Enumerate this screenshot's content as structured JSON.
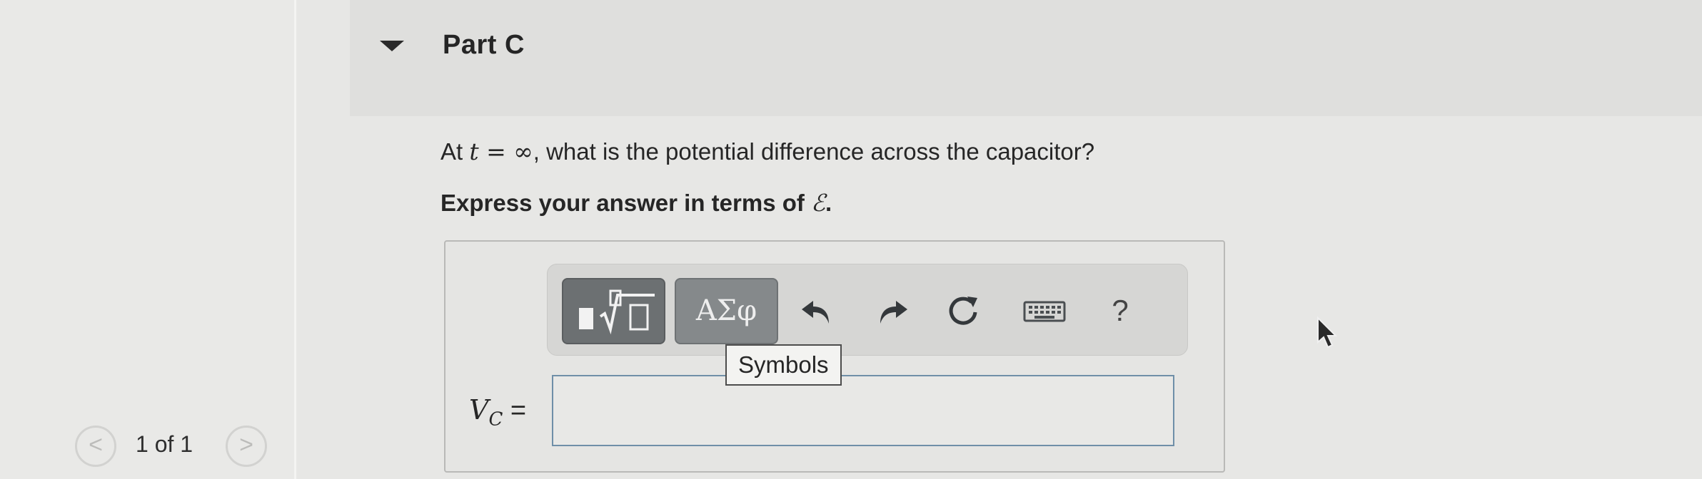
{
  "pager": {
    "prev_label": "<",
    "next_label": ">",
    "text": "1 of 1"
  },
  "part": {
    "title": "Part C"
  },
  "question": {
    "prefix": "At ",
    "var": "t",
    "op": " = ",
    "value": "∞",
    "suffix": ", what is the potential difference across the capacitor?"
  },
  "instruction": {
    "text": "Express your answer in terms of ",
    "symbol": "ℰ",
    "end": "."
  },
  "toolbar": {
    "symbols_label": "ΑΣφ",
    "help_label": "?",
    "icons": [
      "templates-icon",
      "undo-icon",
      "redo-icon",
      "reset-icon",
      "keyboard-icon"
    ]
  },
  "tooltip": {
    "text": "Symbols"
  },
  "answer": {
    "variable": "V",
    "subscript": "C",
    "equals": " =",
    "value": ""
  },
  "colors": {
    "templates_button": "#6c7072",
    "symbols_button": "#85898b",
    "input_border": "#6f8fa8"
  }
}
